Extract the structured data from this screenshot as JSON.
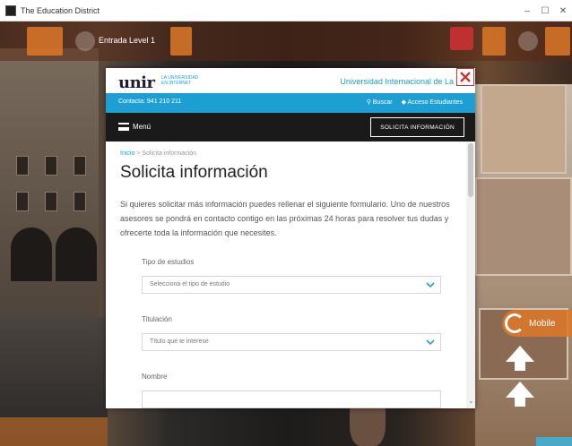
{
  "window": {
    "title": "The Education District",
    "controls": {
      "minimize": "–",
      "maximize": "☐",
      "close": "✕"
    }
  },
  "hud": {
    "label": "Entrada Level 1"
  },
  "side": {
    "mobile_label": "Mobile"
  },
  "modal": {
    "logo": "unir",
    "logo_sub": "LA UNIVERSIDAD EN INTERNET",
    "university_name": "Universidad Internacional de La Rioj",
    "topbar": {
      "phone": "Contacta: 941 210 211",
      "search": "Buscar",
      "student_access": "Acceso Estudiantes"
    },
    "nav": {
      "menu_label": "Menú",
      "cta": "SOLICITA INFORMACIÓN"
    },
    "breadcrumb": {
      "home": "Inicio",
      "separator": ">",
      "current": "Solicita información"
    },
    "title": "Solicita información",
    "intro": "Si quieres solicitar más información puedes rellenar el siguiente formulario. Uno de nuestros asesores se pondrá en contacto contigo en las próximas 24 horas para resolver tus dudas y ofrecerte toda la información que necesites.",
    "form": {
      "study_type_label": "Tipo de estudios",
      "study_type_value": "Selecciona el tipo de estudio",
      "degree_label": "Titulación",
      "degree_value": "Título que te interese",
      "name_label": "Nombre"
    }
  },
  "colors": {
    "brand_blue": "#1e9fd3",
    "brand_navy": "#1c1c3a",
    "nav_dark": "#1a1a1a",
    "close_red": "#cc3333",
    "hud_orange": "#dc7828"
  }
}
